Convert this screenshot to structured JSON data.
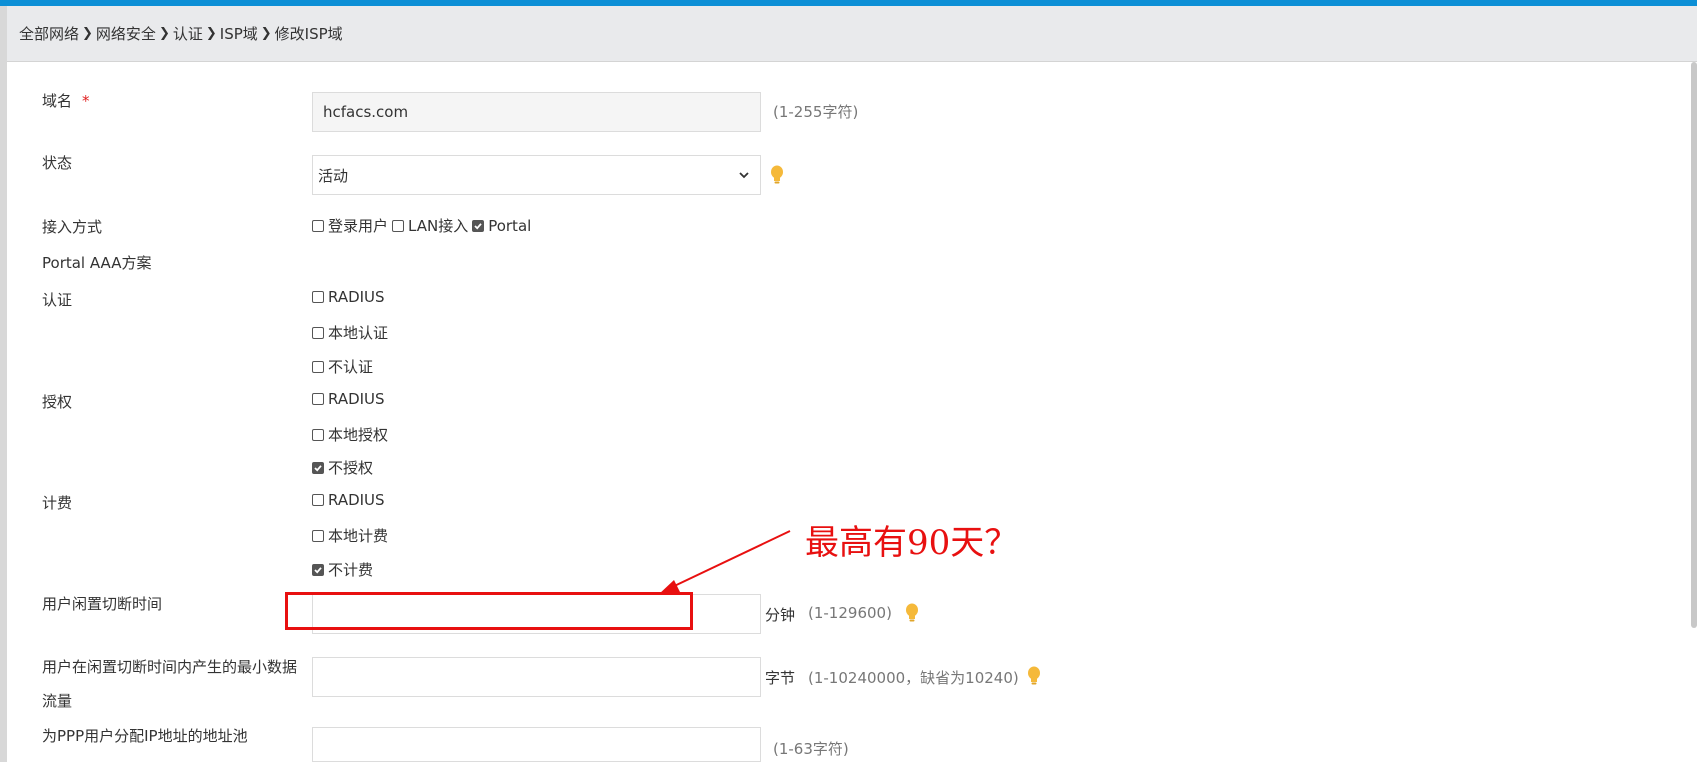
{
  "breadcrumb": [
    "全部网络",
    "网络安全",
    "认证",
    "ISP域",
    "修改ISP域"
  ],
  "form": {
    "domain_name": {
      "label": "域名",
      "required_mark": "*",
      "value": "hcfacs.com",
      "hint": "(1-255字符)"
    },
    "status": {
      "label": "状态",
      "value": "活动"
    },
    "access_mode": {
      "label": "接入方式",
      "options": [
        {
          "label": "登录用户",
          "checked": false
        },
        {
          "label": "LAN接入",
          "checked": false
        },
        {
          "label": "Portal",
          "checked": true
        }
      ]
    },
    "portal_aaa": {
      "label": "Portal AAA方案"
    },
    "auth": {
      "label": "认证",
      "options": [
        {
          "label": "RADIUS",
          "checked": false
        },
        {
          "label": "本地认证",
          "checked": false
        },
        {
          "label": "不认证",
          "checked": false
        }
      ]
    },
    "authorization": {
      "label": "授权",
      "options": [
        {
          "label": "RADIUS",
          "checked": false
        },
        {
          "label": "本地授权",
          "checked": false
        },
        {
          "label": "不授权",
          "checked": true
        }
      ]
    },
    "accounting": {
      "label": "计费",
      "options": [
        {
          "label": "RADIUS",
          "checked": false
        },
        {
          "label": "本地计费",
          "checked": false
        },
        {
          "label": "不计费",
          "checked": true
        }
      ]
    },
    "idle_cut": {
      "label": "用户闲置切断时间",
      "value": "",
      "unit": "分钟",
      "hint": "(1-129600)"
    },
    "min_traffic": {
      "label_line1": "用户在闲置切断时间内产生的最小数据",
      "label_line2": "流量",
      "value": "",
      "unit": "字节",
      "hint": "(1-10240000，缺省为10240)"
    },
    "ppp_pool": {
      "label": "为PPP用户分配IP地址的地址池",
      "value": "",
      "hint": "(1-63字符)"
    }
  },
  "annotation": {
    "text": "最高有90天？"
  },
  "colors": {
    "accent": "#0c8fd6",
    "annotation": "#e81010",
    "bulb": "#f5b93a"
  }
}
